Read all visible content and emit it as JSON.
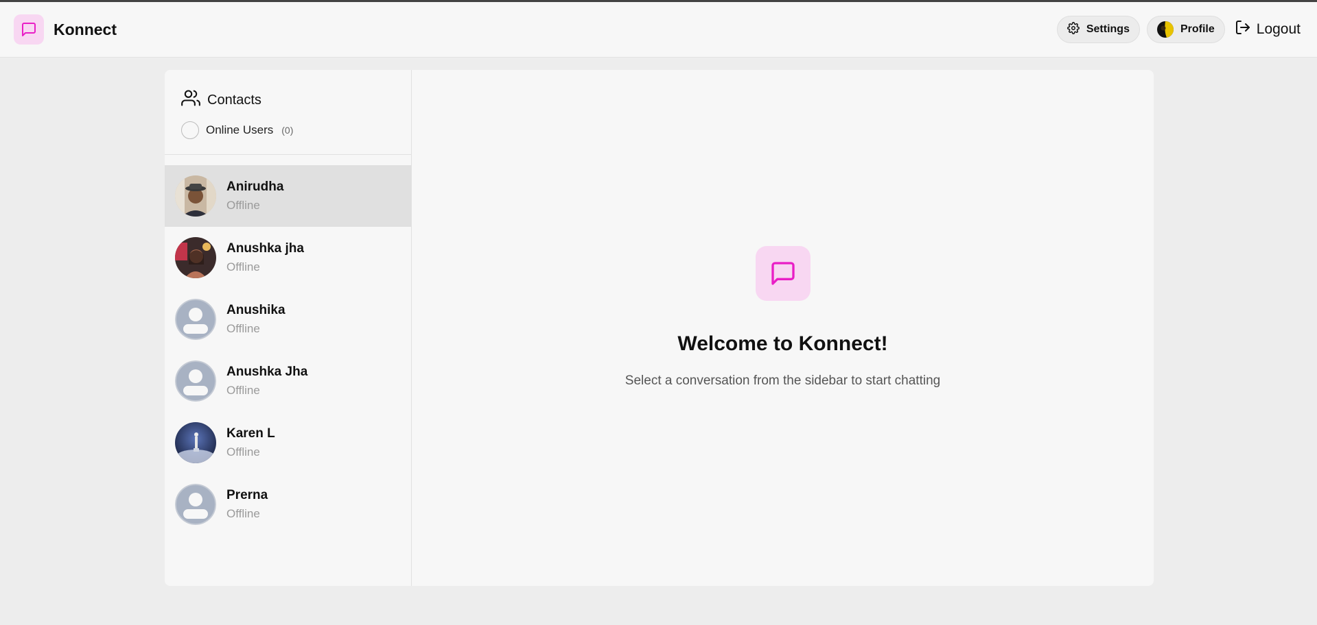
{
  "app": {
    "name": "Konnect",
    "accent": "#e91ec6",
    "accent_bg": "#f8d7f2"
  },
  "header": {
    "settings_label": "Settings",
    "profile_label": "Profile",
    "logout_label": "Logout"
  },
  "sidebar": {
    "title": "Contacts",
    "online_filter_label": "Online Users",
    "online_count": "(0)",
    "contacts": [
      {
        "name": "Anirudha",
        "status": "Offline"
      },
      {
        "name": "Anushka jha",
        "status": "Offline"
      },
      {
        "name": "Anushika",
        "status": "Offline"
      },
      {
        "name": "Anushka Jha",
        "status": "Offline"
      },
      {
        "name": "Karen L",
        "status": "Offline"
      },
      {
        "name": "Prerna",
        "status": "Offline"
      }
    ]
  },
  "main": {
    "welcome_title": "Welcome to Konnect!",
    "welcome_subtitle": "Select a conversation from the sidebar to start chatting"
  }
}
